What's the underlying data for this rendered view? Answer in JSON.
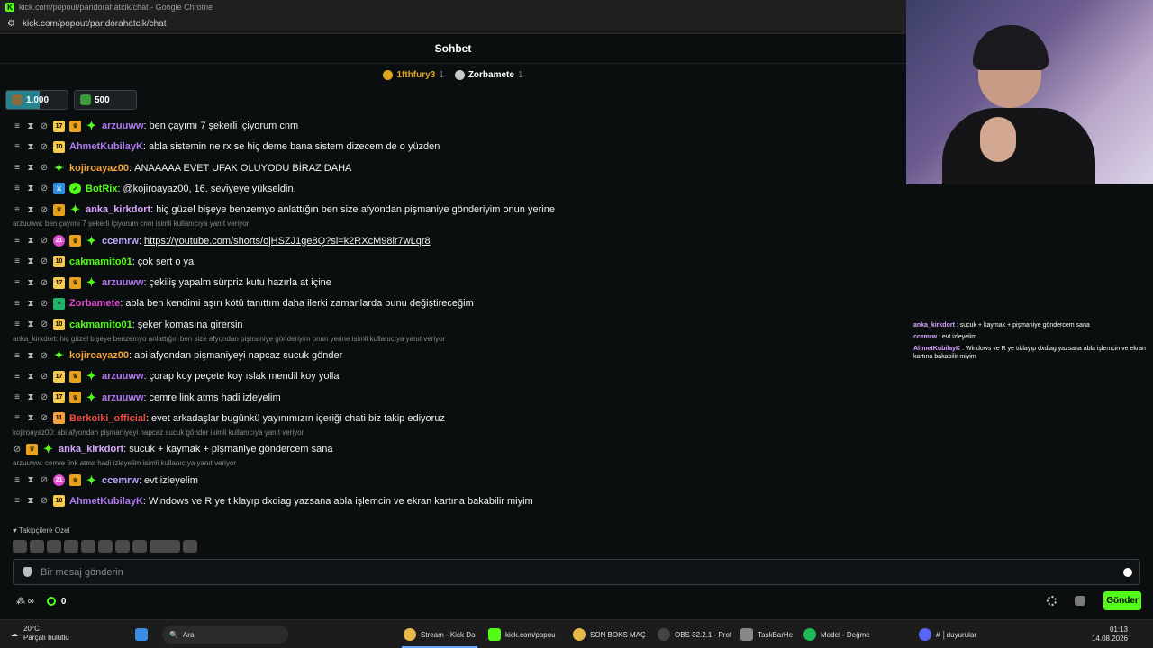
{
  "window": {
    "title": "kick.com/popout/pandorahatcik/chat - Google Chrome",
    "url": "kick.com/popout/pandorahatcik/chat"
  },
  "chat": {
    "header": "Sohbet",
    "pinned": [
      {
        "name": "1fthfury3",
        "count": "1"
      },
      {
        "name": "Zorbamete",
        "count": "1"
      }
    ],
    "goals": [
      {
        "value": "1.000",
        "progress": 0.55
      },
      {
        "value": "500",
        "progress": 0
      }
    ],
    "messages": [
      {
        "user": "arzuuww",
        "color": "#b07bf0",
        "badges": [
          "17",
          "crown",
          "spark"
        ],
        "text": "ben çayımı 7 şekerli içiyorum cnm"
      },
      {
        "user": "AhmetKubilayK",
        "color": "#b07bf0",
        "badges": [
          "10"
        ],
        "text": "abla sistemin ne rx se hiç deme bana sistem dizecem de o yüzden"
      },
      {
        "user": "kojiroayaz00",
        "color": "#f2a13c",
        "badges": [
          "spark"
        ],
        "text": "ANAAAAA EVET UFAK OLUYODU BİRAZ DAHA"
      },
      {
        "user": "BotRix",
        "color": "#53fc18",
        "badges": [
          "bot",
          "verify"
        ],
        "text": "@kojiroayaz00, 16. seviyeye yükseldin."
      },
      {
        "user": "anka_kirkdort",
        "color": "#d9a6ff",
        "badges": [
          "crown",
          "spark"
        ],
        "text": "hiç güzel bişeye benzemyo anlattığın ben size afyondan pişmaniye gönderiyim onun yerine"
      },
      {
        "user": "ccemrw",
        "color": "#b9a6ff",
        "badges": [
          "pink",
          "crown",
          "spark"
        ],
        "text": "https://youtube.com/shorts/ojHSZJ1ge8Q?si=k2RXcM98lr7wLqr8",
        "link": true,
        "reply": "arzuuww: ben çayımı 7 şekerli içiyorum cnm isimli kullanıcıya yanıt veriyor"
      },
      {
        "user": "cakmamito01",
        "color": "#53fc18",
        "badges": [
          "10"
        ],
        "text": "çok sert o ya"
      },
      {
        "user": "arzuuww",
        "color": "#b07bf0",
        "badges": [
          "17",
          "crown",
          "spark"
        ],
        "text": "çekiliş yapalm sürpriz kutu hazırla at içine"
      },
      {
        "user": "Zorbamete",
        "color": "#e04bd1",
        "badges": [
          "green"
        ],
        "text": "abla ben kendimi aşırı kötü tanıttım daha ilerki zamanlarda bunu değiştireceğim"
      },
      {
        "user": "cakmamito01",
        "color": "#53fc18",
        "badges": [
          "10"
        ],
        "text": "şeker komasına girersin"
      },
      {
        "user": "kojiroayaz00",
        "color": "#f2a13c",
        "badges": [
          "spark"
        ],
        "text": "abi afyondan pişmaniyeyi napcaz sucuk gönder",
        "reply": "anka_kirkdort: hiç güzel bişeye benzemyo anlattığın ben size afyondan pişmaniye gönderiyim onun yerine isimli kullanıcıya yanıt veriyor"
      },
      {
        "user": "arzuuww",
        "color": "#b07bf0",
        "badges": [
          "17",
          "crown",
          "spark"
        ],
        "text": "çorap koy peçete koy ıslak mendil koy yolla"
      },
      {
        "user": "arzuuww",
        "color": "#b07bf0",
        "badges": [
          "17",
          "crown",
          "spark"
        ],
        "text": "cemre link atms hadi izleyelim"
      },
      {
        "user": "Berkoiki_official",
        "color": "#f04b3c",
        "badges": [
          "11"
        ],
        "text": "evet arkadaşlar bugünkü yayınımızın içeriği chati biz takip ediyoruz"
      },
      {
        "user": "anka_kirkdort",
        "color": "#d9a6ff",
        "badges": [
          "crown",
          "spark"
        ],
        "text": "sucuk + kaymak + pişmaniye göndercem sana",
        "reply": "kojiroayaz00: abi afyondan pişmaniyeyi napcaz sucuk gönder isimli kullanıcıya yanıt veriyor",
        "nomod": true
      },
      {
        "user": "ccemrw",
        "color": "#b9a6ff",
        "badges": [
          "pink",
          "crown",
          "spark"
        ],
        "text": "evt izleyelim",
        "reply": "arzuuww: cemre link atms hadi izleyelim isimli kullanıcıya yanıt veriyor"
      },
      {
        "user": "AhmetKubilayK",
        "color": "#b07bf0",
        "badges": [
          "10"
        ],
        "text": "Windows ve R ye tıklayıp dxdiag yazsana abla işlemcin ve ekran kartına bakabilir miyim"
      }
    ],
    "followers_label": "Takipçilere Özel",
    "input_placeholder": "Bir mesaj gönderin",
    "points": "0",
    "send_label": "Gönder"
  },
  "overlay": [
    {
      "user": "anka_kirkdort",
      "text": "sucuk + kaymak + pişmaniye göndercem sana"
    },
    {
      "user": "ccemrw",
      "text": "evt izleyelim"
    },
    {
      "user": "AhmetKubilayK",
      "text": "Windows ve R ye tıklayıp dxdiag yazsana abla işlemcin ve ekran kartına bakabilir miyim"
    }
  ],
  "taskbar": {
    "weather_temp": "20°C",
    "weather_desc": "Parçalı bulutlu",
    "search": "Ara",
    "items": [
      "Stream - Kick Da",
      "kick.com/popou",
      "SON BOKS MAÇ",
      "OBS 32.2.1 - Prof",
      "TaskBarHe",
      "Model - Değme",
      "# │duyurular"
    ],
    "time": "01:13",
    "date": "14.08.2026"
  },
  "colors": {
    "accent": "#53fc18",
    "background": "#0b0e0f"
  }
}
